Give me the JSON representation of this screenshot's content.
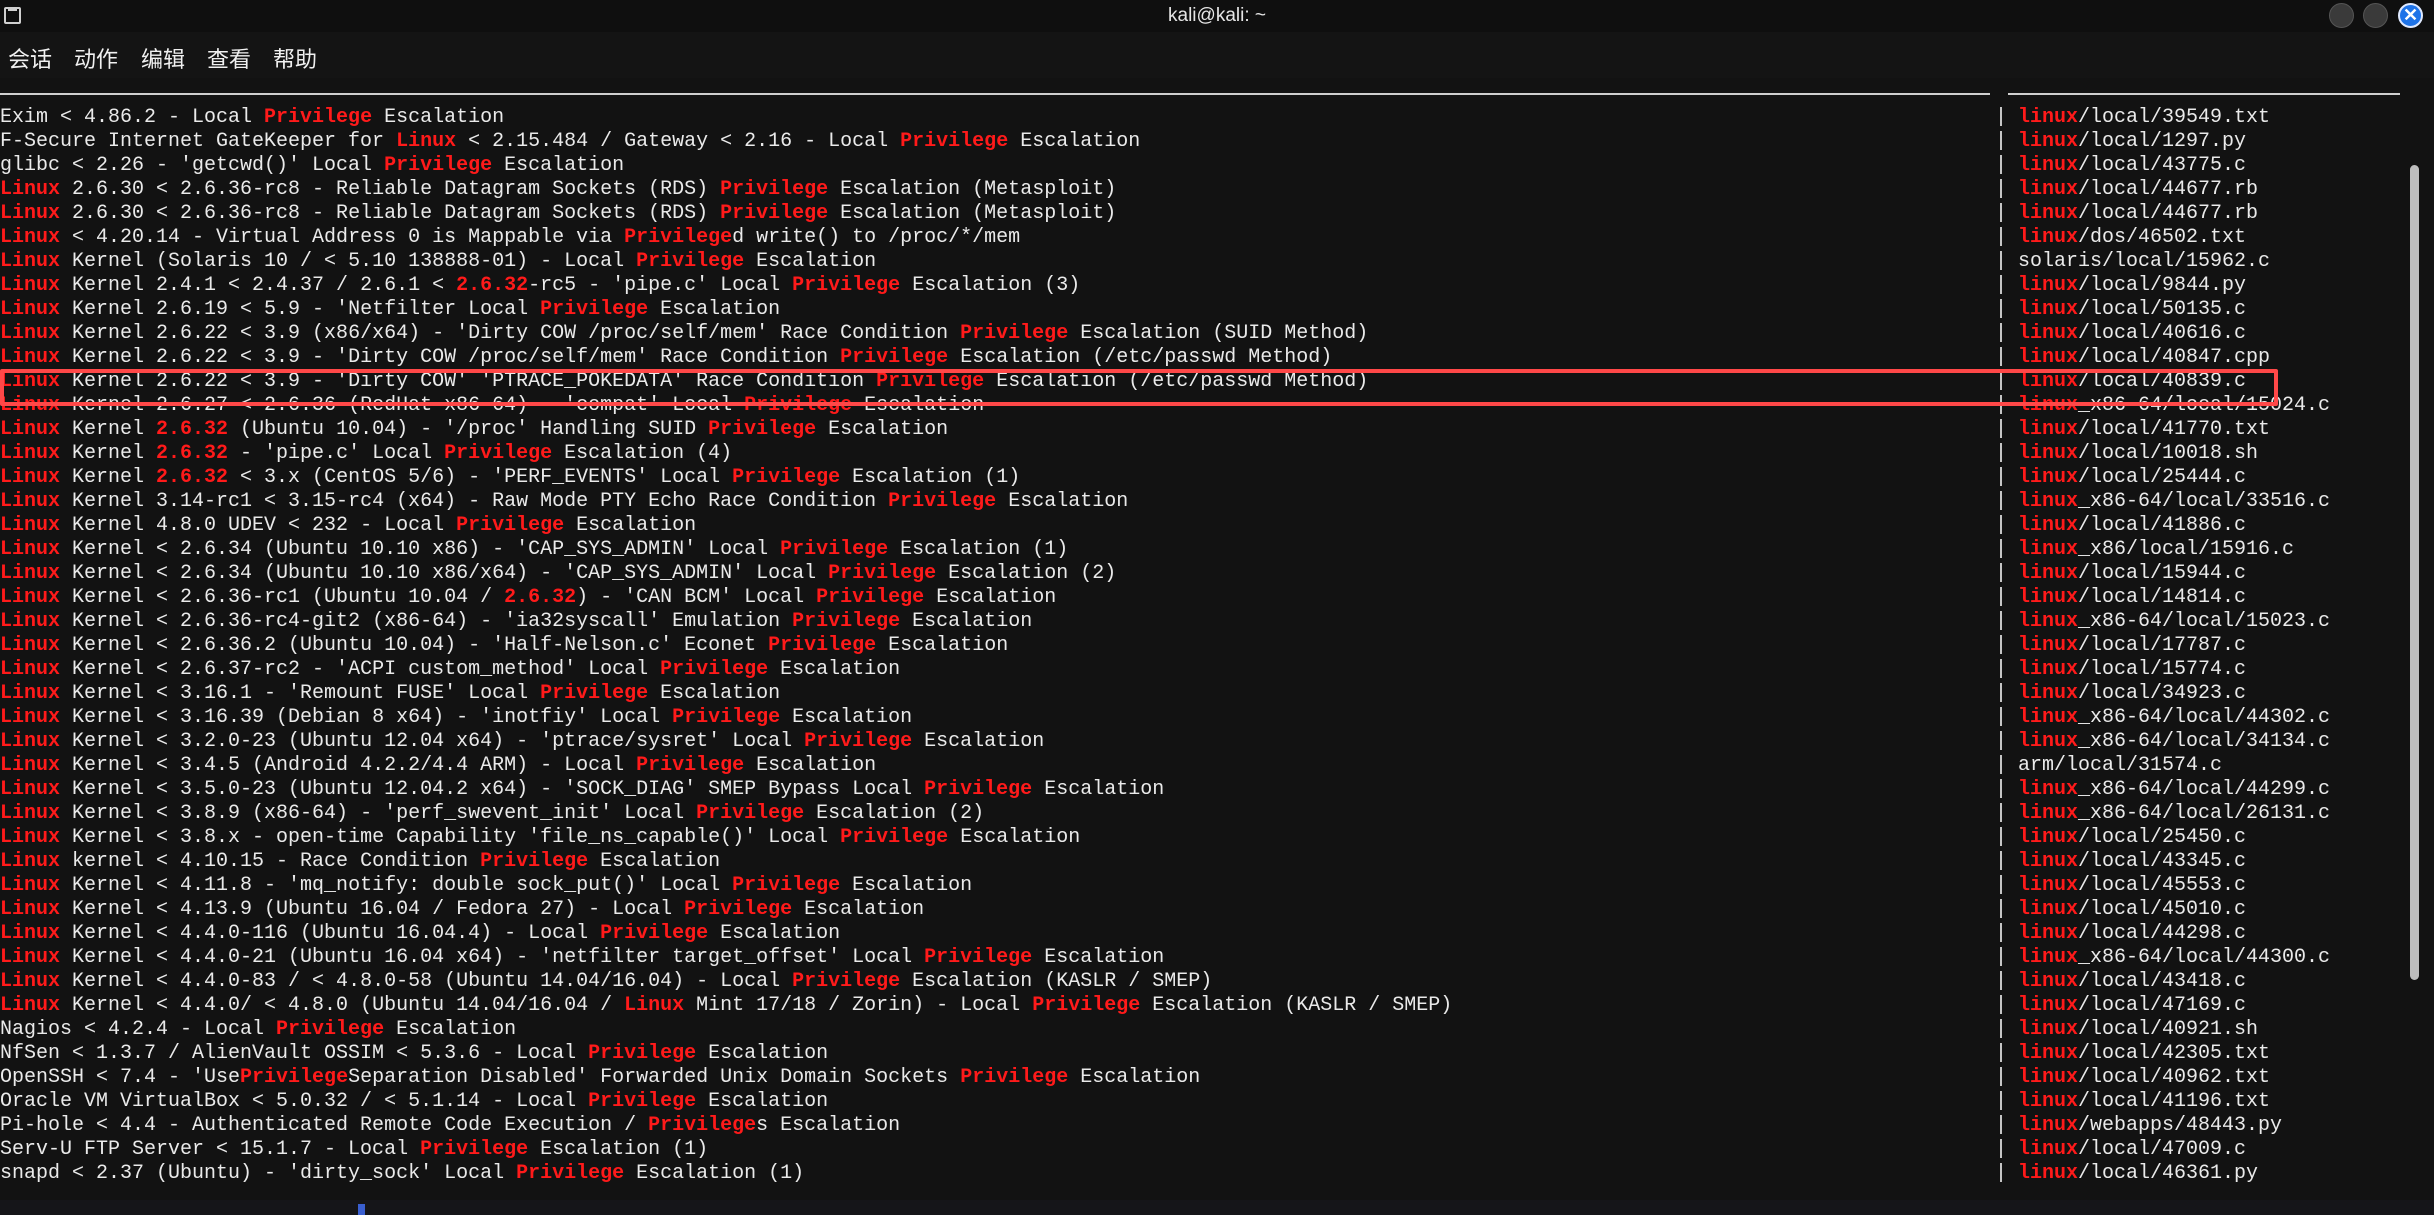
{
  "window": {
    "title": "kali@kali: ~",
    "icon": "terminal-icon",
    "close_glyph": "✕"
  },
  "menu": [
    "会话",
    "动作",
    "编辑",
    "查看",
    "帮助"
  ],
  "highlight_word_colors": {
    "keyword": "#ff1a1a",
    "text": "#eaeaea",
    "box": "#ff4848"
  },
  "separator": "|",
  "rows": [
    {
      "title": "Exim < 4.86.2 - Local Privilege Escalation",
      "path": "linux/local/39549.txt"
    },
    {
      "title": "F-Secure Internet GateKeeper for Linux < 2.15.484 / Gateway < 2.16 - Local Privilege Escalation",
      "path": "linux/local/1297.py"
    },
    {
      "title": "glibc < 2.26 - 'getcwd()' Local Privilege Escalation",
      "path": "linux/local/43775.c"
    },
    {
      "title": "Linux 2.6.30 < 2.6.36-rc8 - Reliable Datagram Sockets (RDS) Privilege Escalation (Metasploit)",
      "path": "linux/local/44677.rb"
    },
    {
      "title": "Linux 2.6.30 < 2.6.36-rc8 - Reliable Datagram Sockets (RDS) Privilege Escalation (Metasploit)",
      "path": "linux/local/44677.rb"
    },
    {
      "title": "Linux < 4.20.14 - Virtual Address 0 is Mappable via Privileged write() to /proc/*/mem",
      "path": "linux/dos/46502.txt"
    },
    {
      "title": "Linux Kernel (Solaris 10 / < 5.10 138888-01) - Local Privilege Escalation",
      "path": "solaris/local/15962.c"
    },
    {
      "title": "Linux Kernel 2.4.1 < 2.4.37 / 2.6.1 < 2.6.32-rc5 - 'pipe.c' Local Privilege Escalation (3)",
      "path": "linux/local/9844.py"
    },
    {
      "title": "Linux Kernel 2.6.19 < 5.9 - 'Netfilter Local Privilege Escalation",
      "path": "linux/local/50135.c"
    },
    {
      "title": "Linux Kernel 2.6.22 < 3.9 (x86/x64) - 'Dirty COW /proc/self/mem' Race Condition Privilege Escalation (SUID Method)",
      "path": "linux/local/40616.c"
    },
    {
      "title": "Linux Kernel 2.6.22 < 3.9 - 'Dirty COW /proc/self/mem' Race Condition Privilege Escalation (/etc/passwd Method)",
      "path": "linux/local/40847.cpp"
    },
    {
      "title": "Linux Kernel 2.6.22 < 3.9 - 'Dirty COW' 'PTRACE_POKEDATA' Race Condition Privilege Escalation (/etc/passwd Method)",
      "path": "linux/local/40839.c"
    },
    {
      "title": "Linux Kernel 2.6.27 < 2.6.36 (RedHat x86-64) - 'compat' Local Privilege Escalation",
      "path": "linux_x86-64/local/15024.c"
    },
    {
      "title": "Linux Kernel 2.6.32 (Ubuntu 10.04) - '/proc' Handling SUID Privilege Escalation",
      "path": "linux/local/41770.txt"
    },
    {
      "title": "Linux Kernel 2.6.32 - 'pipe.c' Local Privilege Escalation (4)",
      "path": "linux/local/10018.sh"
    },
    {
      "title": "Linux Kernel 2.6.32 < 3.x (CentOS 5/6) - 'PERF_EVENTS' Local Privilege Escalation (1)",
      "path": "linux/local/25444.c"
    },
    {
      "title": "Linux Kernel 3.14-rc1 < 3.15-rc4 (x64) - Raw Mode PTY Echo Race Condition Privilege Escalation",
      "path": "linux_x86-64/local/33516.c"
    },
    {
      "title": "Linux Kernel 4.8.0 UDEV < 232 - Local Privilege Escalation",
      "path": "linux/local/41886.c"
    },
    {
      "title": "Linux Kernel < 2.6.34 (Ubuntu 10.10 x86) - 'CAP_SYS_ADMIN' Local Privilege Escalation (1)",
      "path": "linux_x86/local/15916.c"
    },
    {
      "title": "Linux Kernel < 2.6.34 (Ubuntu 10.10 x86/x64) - 'CAP_SYS_ADMIN' Local Privilege Escalation (2)",
      "path": "linux/local/15944.c"
    },
    {
      "title": "Linux Kernel < 2.6.36-rc1 (Ubuntu 10.04 / 2.6.32) - 'CAN BCM' Local Privilege Escalation",
      "path": "linux/local/14814.c"
    },
    {
      "title": "Linux Kernel < 2.6.36-rc4-git2 (x86-64) - 'ia32syscall' Emulation Privilege Escalation",
      "path": "linux_x86-64/local/15023.c"
    },
    {
      "title": "Linux Kernel < 2.6.36.2 (Ubuntu 10.04) - 'Half-Nelson.c' Econet Privilege Escalation",
      "path": "linux/local/17787.c"
    },
    {
      "title": "Linux Kernel < 2.6.37-rc2 - 'ACPI custom_method' Local Privilege Escalation",
      "path": "linux/local/15774.c"
    },
    {
      "title": "Linux Kernel < 3.16.1 - 'Remount FUSE' Local Privilege Escalation",
      "path": "linux/local/34923.c"
    },
    {
      "title": "Linux Kernel < 3.16.39 (Debian 8 x64) - 'inotfiy' Local Privilege Escalation",
      "path": "linux_x86-64/local/44302.c"
    },
    {
      "title": "Linux Kernel < 3.2.0-23 (Ubuntu 12.04 x64) - 'ptrace/sysret' Local Privilege Escalation",
      "path": "linux_x86-64/local/34134.c"
    },
    {
      "title": "Linux Kernel < 3.4.5 (Android 4.2.2/4.4 ARM) - Local Privilege Escalation",
      "path": "arm/local/31574.c"
    },
    {
      "title": "Linux Kernel < 3.5.0-23 (Ubuntu 12.04.2 x64) - 'SOCK_DIAG' SMEP Bypass Local Privilege Escalation",
      "path": "linux_x86-64/local/44299.c"
    },
    {
      "title": "Linux Kernel < 3.8.9 (x86-64) - 'perf_swevent_init' Local Privilege Escalation (2)",
      "path": "linux_x86-64/local/26131.c"
    },
    {
      "title": "Linux Kernel < 3.8.x - open-time Capability 'file_ns_capable()' Local Privilege Escalation",
      "path": "linux/local/25450.c"
    },
    {
      "title": "Linux kernel < 4.10.15 - Race Condition Privilege Escalation",
      "path": "linux/local/43345.c"
    },
    {
      "title": "Linux Kernel < 4.11.8 - 'mq_notify: double sock_put()' Local Privilege Escalation",
      "path": "linux/local/45553.c"
    },
    {
      "title": "Linux Kernel < 4.13.9 (Ubuntu 16.04 / Fedora 27) - Local Privilege Escalation",
      "path": "linux/local/45010.c"
    },
    {
      "title": "Linux Kernel < 4.4.0-116 (Ubuntu 16.04.4) - Local Privilege Escalation",
      "path": "linux/local/44298.c"
    },
    {
      "title": "Linux Kernel < 4.4.0-21 (Ubuntu 16.04 x64) - 'netfilter target_offset' Local Privilege Escalation",
      "path": "linux_x86-64/local/44300.c"
    },
    {
      "title": "Linux Kernel < 4.4.0-83 / < 4.8.0-58 (Ubuntu 14.04/16.04) - Local Privilege Escalation (KASLR / SMEP)",
      "path": "linux/local/43418.c"
    },
    {
      "title": "Linux Kernel < 4.4.0/ < 4.8.0 (Ubuntu 14.04/16.04 / Linux Mint 17/18 / Zorin) - Local Privilege Escalation (KASLR / SMEP)",
      "path": "linux/local/47169.c"
    },
    {
      "title": "Nagios < 4.2.4 - Local Privilege Escalation",
      "path": "linux/local/40921.sh"
    },
    {
      "title": "NfSen < 1.3.7 / AlienVault OSSIM < 5.3.6 - Local Privilege Escalation",
      "path": "linux/local/42305.txt"
    },
    {
      "title": "OpenSSH < 7.4 - 'UsePrivilegeSeparation Disabled' Forwarded Unix Domain Sockets Privilege Escalation",
      "path": "linux/local/40962.txt"
    },
    {
      "title": "Oracle VM VirtualBox < 5.0.32 / < 5.1.14 - Local Privilege Escalation",
      "path": "linux/local/41196.txt"
    },
    {
      "title": "Pi-hole < 4.4 - Authenticated Remote Code Execution / Privileges Escalation",
      "path": "linux/webapps/48443.py"
    },
    {
      "title": "Serv-U FTP Server < 15.1.7 - Local Privilege Escalation (1)",
      "path": "linux/local/47009.c"
    },
    {
      "title": "snapd < 2.37 (Ubuntu) - 'dirty_sock' Local Privilege Escalation (1)",
      "path": "linux/local/46361.py"
    }
  ],
  "highlight_terms": [
    "Privilege",
    "Linux",
    "linux",
    "2.6.32"
  ]
}
